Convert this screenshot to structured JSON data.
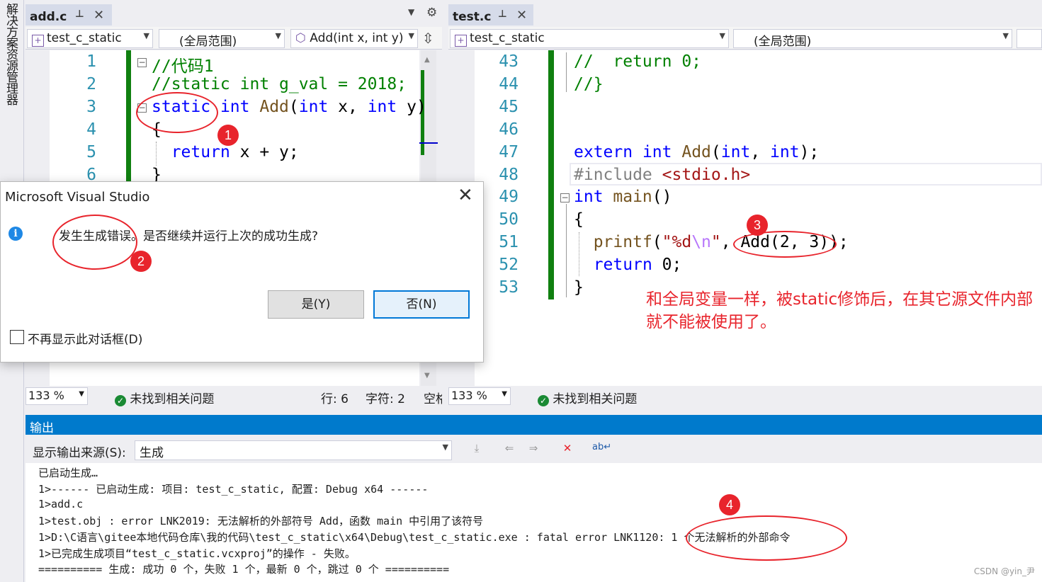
{
  "side_panel": {
    "label": "解决方案资源管理器"
  },
  "left_pane": {
    "tab": {
      "title": "add.c",
      "pin": "⊥",
      "close": "✕"
    },
    "nav": {
      "project": "test_c_static",
      "scope": "(全局范围)",
      "function": "Add(int x, int y)"
    },
    "lines": [
      "1",
      "2",
      "3",
      "4",
      "5",
      "6"
    ],
    "code": {
      "l1": "//代码1",
      "l2": "//static int g_val = 2018;",
      "l3_kw": "static",
      "l3_rest_kw": "int",
      "l3_fn": "Add",
      "l3_args_a": "(",
      "l3_int1": "int",
      "l3_x": " x, ",
      "l3_int2": "int",
      "l3_y": " y)",
      "l4": "{",
      "l5_kw": "return",
      "l5_rest": " x + y;",
      "l6": "}"
    },
    "status": {
      "zoom": "133 %",
      "issues": "未找到相关问题",
      "row": "行: 6",
      "col": "字符: 2",
      "extra": "空格"
    }
  },
  "right_pane": {
    "tab": {
      "title": "test.c",
      "pin": "⊥",
      "close": "✕"
    },
    "nav": {
      "project": "test_c_static",
      "scope": "(全局范围)"
    },
    "lines": [
      "43",
      "44",
      "45",
      "46",
      "47",
      "48",
      "49",
      "50",
      "51",
      "52",
      "53"
    ],
    "code": {
      "l43": "//  return 0;",
      "l44": "//}",
      "l47_kw1": "extern",
      "l47_kw2": "int",
      "l47_fn": "Add",
      "l47_p1": "(",
      "l47_int1": "int",
      "l47_comma": ", ",
      "l47_int2": "int",
      "l47_end": ");",
      "l48_pp": "#include ",
      "l48_hdr": "<stdio.h>",
      "l49_kw": "int",
      "l49_fn": " main",
      "l49_end": "()",
      "l50": "{",
      "l51_fn": "printf",
      "l51_p": "(",
      "l51_str1": "\"%d",
      "l51_esc": "\\n",
      "l51_str2": "\"",
      "l51_rest": ", Add(2, 3));",
      "l52_kw": "return",
      "l52_rest": " 0;",
      "l53": "}"
    },
    "status": {
      "zoom": "133 %",
      "issues": "未找到相关问题"
    }
  },
  "output": {
    "title": "输出",
    "source_label": "显示输出来源(S):",
    "source_value": "生成",
    "lines": [
      "已启动生成…",
      "1>------ 已启动生成: 项目: test_c_static, 配置: Debug x64 ------",
      "1>add.c",
      "1>test.obj : error LNK2019: 无法解析的外部符号 Add，函数 main 中引用了该符号",
      "1>D:\\C语言\\gitee本地代码仓库\\我的代码\\test_c_static\\x64\\Debug\\test_c_static.exe : fatal error LNK1120: 1 个无法解析的外部命令",
      "1>已完成生成项目“test_c_static.vcxproj”的操作 - 失败。",
      "========== 生成: 成功 0 个，失败 1 个，最新 0 个，跳过 0 个 =========="
    ]
  },
  "dialog": {
    "title": "Microsoft Visual Studio",
    "close": "✕",
    "message": "发生生成错误。是否继续并运行上次的成功生成?",
    "yes": "是(Y)",
    "no": "否(N)",
    "checkbox": "不再显示此对话框(D)"
  },
  "annotations": {
    "n1": "1",
    "n2": "2",
    "n3": "3",
    "n4": "4",
    "note": "和全局变量一样，被static修饰后，在其它源文件内部就不能被使用了。"
  },
  "watermark": "CSDN @yin_尹",
  "colors": {
    "accent": "#007acc",
    "annotation": "#e8242c",
    "change_bar": "#108010"
  }
}
